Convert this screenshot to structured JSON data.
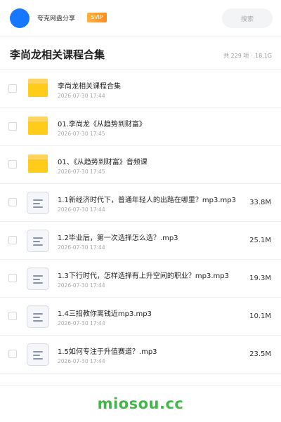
{
  "header": {
    "app_name": "夸克网盘分享",
    "badge": "SVIP",
    "search_placeholder": "搜索",
    "avatar_color": "#1677ff"
  },
  "folder": {
    "title": "李尚龙相关课程合集",
    "count_text": "共 229 项",
    "separator": "·",
    "total_size": "18.1G"
  },
  "items": [
    {
      "type": "folder",
      "name": "李尚龙相关课程合集",
      "date": "2026-07-30 17:44",
      "size": ""
    },
    {
      "type": "folder",
      "name": "01.李尚龙《从趋势到财富》",
      "date": "2026-07-30 17:45",
      "size": ""
    },
    {
      "type": "folder",
      "name": "01、《从趋势到财富》音频课",
      "date": "2026-07-30 17:45",
      "size": ""
    },
    {
      "type": "file",
      "name": "1.1新经济时代下，普通年轻人的出路在哪里？mp3.mp3",
      "date": "2026-07-30 17:44",
      "size": "33.8M"
    },
    {
      "type": "file",
      "name": "1.2毕业后，第一次选择怎么选？.mp3",
      "date": "2026-07-30 17:44",
      "size": "25.1M"
    },
    {
      "type": "file",
      "name": "1.3下行时代，怎样选择有上升空间的职业？mp3.mp3",
      "date": "2026-07-30 17:44",
      "size": "19.3M"
    },
    {
      "type": "file",
      "name": "1.4三招教你离钱近mp3.mp3",
      "date": "2026-07-30 17:44",
      "size": "10.1M"
    },
    {
      "type": "file",
      "name": "1.5如何专注于升值赛道？.mp3",
      "date": "2026-07-30 17:44",
      "size": "23.5M"
    }
  ],
  "watermark": "miosou.cc",
  "colors": {
    "accent_orange": "#ff8a1f",
    "folder_yellow": "#ffcc1a",
    "watermark_green": "#43b649"
  }
}
